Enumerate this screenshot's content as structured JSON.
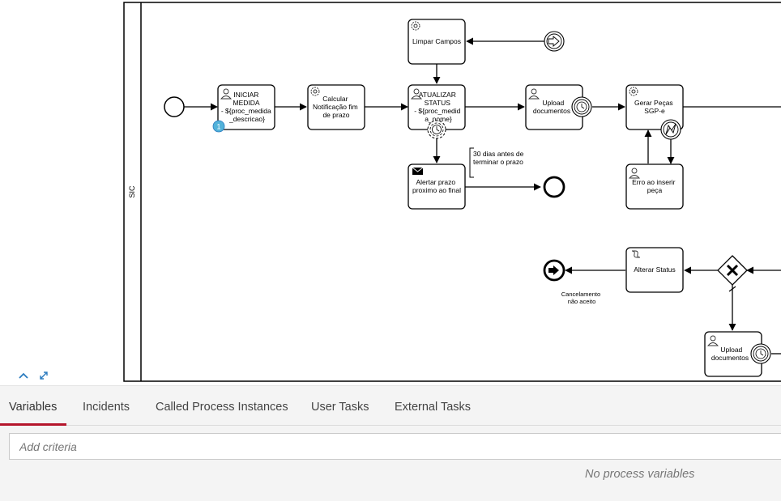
{
  "diagram": {
    "lane_label": "SIC",
    "tasks": {
      "iniciar": [
        "INICIAR",
        "MEDIDA",
        "- ${proc_medida",
        "_descricao}"
      ],
      "calcular": [
        "Calcular",
        "Notificação fim",
        "de prazo"
      ],
      "limpar": [
        "Limpar Campos"
      ],
      "atualizar": [
        "ATUALIZAR",
        "STATUS",
        "- ${proc_medid",
        "a_nome}"
      ],
      "upload1": [
        "Upload",
        "documentos"
      ],
      "gerar": [
        "Gerar Peças",
        "SGP-e"
      ],
      "alertar": [
        "Alertar prazo",
        "proximo ao final"
      ],
      "erro": [
        "Erro ao inserir",
        "peça"
      ],
      "alterar": [
        "Alterar Status"
      ],
      "upload2": [
        "Upload",
        "documentos"
      ]
    },
    "badge_count": "1",
    "annotation": [
      "30 dias antes de",
      "terminar o prazo"
    ],
    "end_event_label": [
      "Cancelamento",
      "não aceito"
    ]
  },
  "tabs": [
    {
      "label": "Variables",
      "active": true
    },
    {
      "label": "Incidents"
    },
    {
      "label": "Called Process Instances"
    },
    {
      "label": "User Tasks"
    },
    {
      "label": "External Tasks"
    }
  ],
  "filter": {
    "placeholder": "Add criteria"
  },
  "empty_message": "No process variables",
  "colors": {
    "accent": "#b5152b",
    "badge": "#52b2d9",
    "control_icons": "#2b7bbf"
  }
}
